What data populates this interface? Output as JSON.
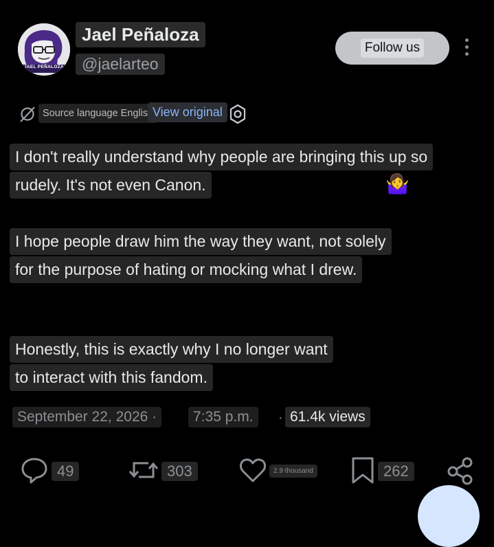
{
  "author": {
    "display_name": "Jael Peñaloza",
    "handle": "@jaelarteo",
    "avatar_text": "JAEL PEÑALOZA"
  },
  "header": {
    "follow_label": "Follow us",
    "more_icon": "more-vertical-icon"
  },
  "translation": {
    "source_language": "Source language English",
    "view_original": "View original",
    "settings_icon": "gear-icon"
  },
  "post": {
    "paragraphs": [
      [
        "I don't really understand why people are bringing this up so",
        "rudely. It's not even Canon."
      ],
      [
        "I hope people draw him the way they want, not solely",
        "for the purpose of hating or mocking what I drew."
      ],
      [
        "Honestly, this is exactly why I no longer want",
        "to interact with this fandom."
      ]
    ],
    "emoji": "🤷‍♀️"
  },
  "meta": {
    "date": "September 22, 2026 ·",
    "time": "7:35 p.m.",
    "separator": "·",
    "views": "61.4k views"
  },
  "actions": {
    "replies": "49",
    "reposts": "303",
    "likes": "2.9 thousand",
    "bookmarks": "262"
  },
  "colors": {
    "background": "#000000",
    "text": "#e7e9ea",
    "muted": "#8b8f93",
    "link": "#8ab4f8",
    "follow_bg": "#c2c6c9"
  }
}
